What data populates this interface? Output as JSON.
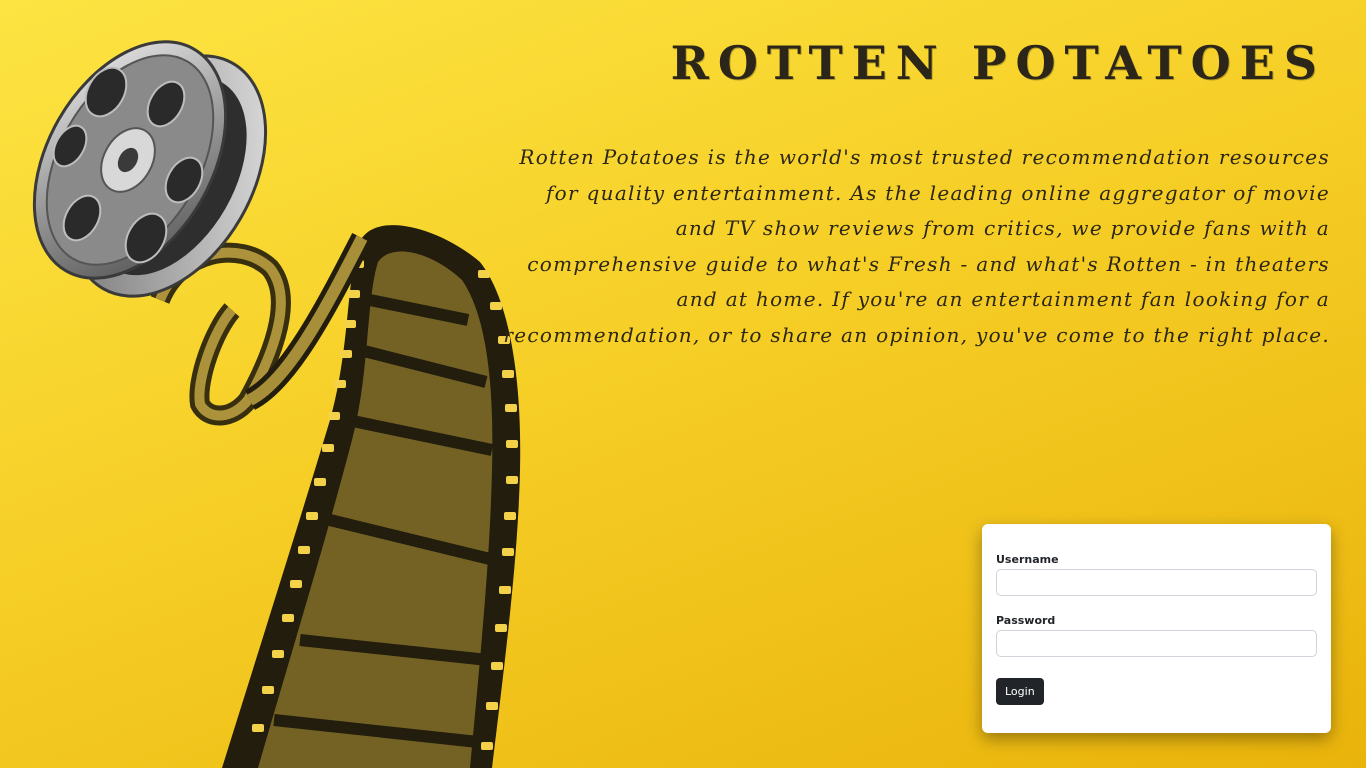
{
  "site": {
    "title": "ROTTEN POTATOES",
    "description": "Rotten Potatoes is the world's most trusted recommendation resources for quality entertainment. As the leading online aggregator of movie and TV show reviews from critics, we provide fans with a comprehensive guide to what's Fresh - and what's Rotten - in theaters and at home. If you're an entertainment fan looking for a recommendation, or to share an opinion, you've come to the right place."
  },
  "login": {
    "username_label": "Username",
    "username_value": "",
    "password_label": "Password",
    "password_value": "",
    "submit_label": "Login"
  },
  "illustration": {
    "icon": "film-reel-icon"
  },
  "colors": {
    "background": "#f6cf27",
    "text": "#2b2619",
    "button": "#212529",
    "card": "#ffffff"
  }
}
